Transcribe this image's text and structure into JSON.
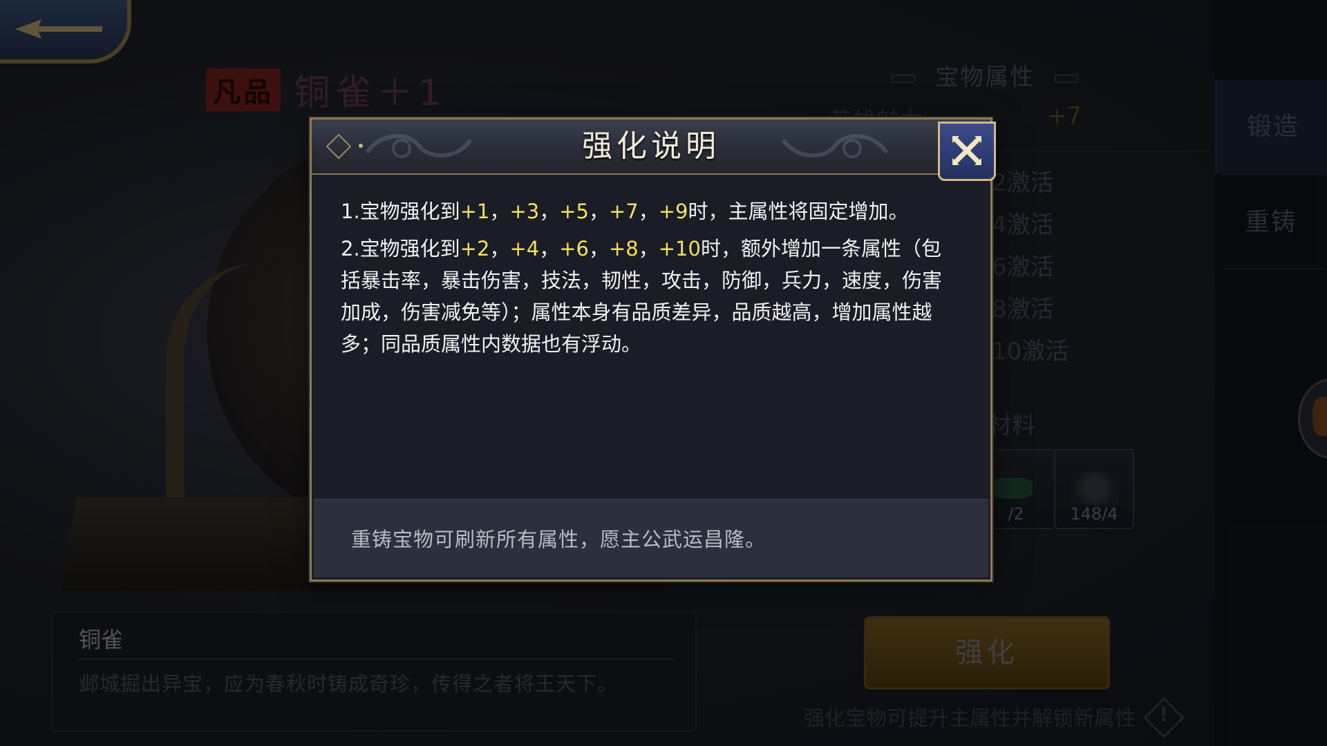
{
  "header": {
    "rarity": "凡品",
    "item_title": "铜雀＋1"
  },
  "item_desc": {
    "name": "铜雀",
    "text": "邺城掘出异宝，应为春秋时铸成奇珍，传得之者将王天下。"
  },
  "attributes": {
    "header": "宝物属性",
    "main_attr_name": "英雄魅力",
    "main_attr_value": "+7",
    "activations": [
      "2激活",
      "4激活",
      "6激活",
      "8激活",
      "10激活"
    ]
  },
  "materials": {
    "label": "材料",
    "slots": [
      {
        "count": "/2",
        "icon": "green-gem-icon"
      },
      {
        "count": "148/4",
        "icon": "ore-icon"
      }
    ]
  },
  "sidebar": {
    "tabs": [
      {
        "label": "锻造",
        "active": true
      },
      {
        "label": "重铸",
        "active": false
      }
    ]
  },
  "strengthen": {
    "button_label": "强化",
    "hint": "强化宝物可提升主属性并解锁新属性",
    "hint_icon": "!"
  },
  "modal": {
    "title": "强化说明",
    "rule1": {
      "prefix": "1.宝物强化到",
      "v1": "+1",
      "v2": "+3",
      "v3": "+5",
      "v4": "+7",
      "v5": "+9",
      "sep": "，",
      "suffix": "时，主属性将固定增加。"
    },
    "rule2": {
      "prefix": "2.宝物强化到",
      "v1": "+2",
      "v2": "+4",
      "v3": "+6",
      "v4": "+8",
      "v5": "+10",
      "sep": "，",
      "suffix": "时，额外增加一条属性（包括暴击率，暴击伤害，技法，韧性，攻击，防御，兵力，速度，伤害加成，伤害减免等）；属性本身有品质差异，品质越高，增加属性越多；同品质属性内数据也有浮动。"
    },
    "footer": "重铸宝物可刷新所有属性，愿主公武运昌隆。"
  },
  "colors": {
    "highlight": "#f4e15c",
    "modal_border": "#8c7a55",
    "close_button": "#2f3d76"
  }
}
